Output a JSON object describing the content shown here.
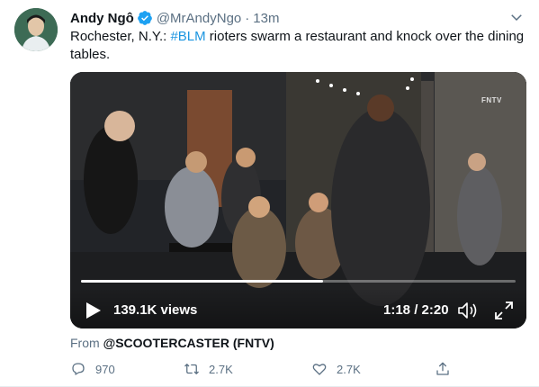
{
  "tweet": {
    "author_name": "Andy Ngô",
    "handle": "@MrAndyNgo",
    "separator": "·",
    "time": "13m",
    "text_before": "Rochester, N.Y.: ",
    "hashtag": "#BLM",
    "text_after": " rioters swarm a restaurant and knock over the dining tables.",
    "verified": true
  },
  "video": {
    "views": "139.1K views",
    "timecode": "1:18 / 2:20",
    "progress": 0.557,
    "watermark": "FNTV"
  },
  "attribution": {
    "prefix": "From ",
    "source": "@SCOOTERCASTER (FNTV)"
  },
  "actions": {
    "replies": "970",
    "retweets": "2.7K",
    "likes": "2.7K"
  },
  "colors": {
    "accent": "#1b95e0",
    "secondary_text": "#5b7083",
    "primary_text": "#0f1419"
  },
  "icons": [
    "verified-badge-icon",
    "chevron-down-icon",
    "play-icon",
    "volume-icon",
    "fullscreen-icon",
    "reply-icon",
    "retweet-icon",
    "like-icon",
    "share-icon"
  ]
}
